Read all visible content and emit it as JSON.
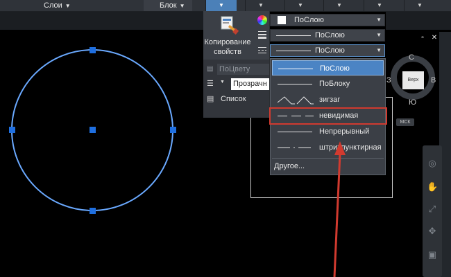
{
  "ribbon": {
    "panel_layers": "Слои",
    "panel_block": "Блок"
  },
  "properties": {
    "match_properties_label_line1": "Копирование",
    "match_properties_label_line2": "свойств",
    "plot_style_placeholder": "ПоЦвету",
    "transparency_value": "Прозрачн",
    "list_label": "Список",
    "color_combo": "ПоСлою",
    "lineweight_combo": "ПоСлою",
    "linetype_combo": "ПоСлою"
  },
  "linetype_dropdown": {
    "items": [
      {
        "label": "ПоСлою",
        "selected": true
      },
      {
        "label": "ПоБлоку",
        "selected": false
      },
      {
        "label": "зигзаг",
        "selected": false
      },
      {
        "label": "невидимая",
        "selected": false
      },
      {
        "label": "Непрерывный",
        "selected": false
      },
      {
        "label": "штрихпунктирная",
        "selected": false
      }
    ],
    "other": "Другое..."
  },
  "viewcube": {
    "face": "Верх",
    "north": "С",
    "south": "Ю",
    "east": "В",
    "west": "З",
    "ucs_badge": "МСК"
  },
  "colors": {
    "accent": "#4b84c4",
    "highlight": "#d13a2f",
    "circle": "#6aa9ff",
    "grip": "#1f6fe0"
  }
}
